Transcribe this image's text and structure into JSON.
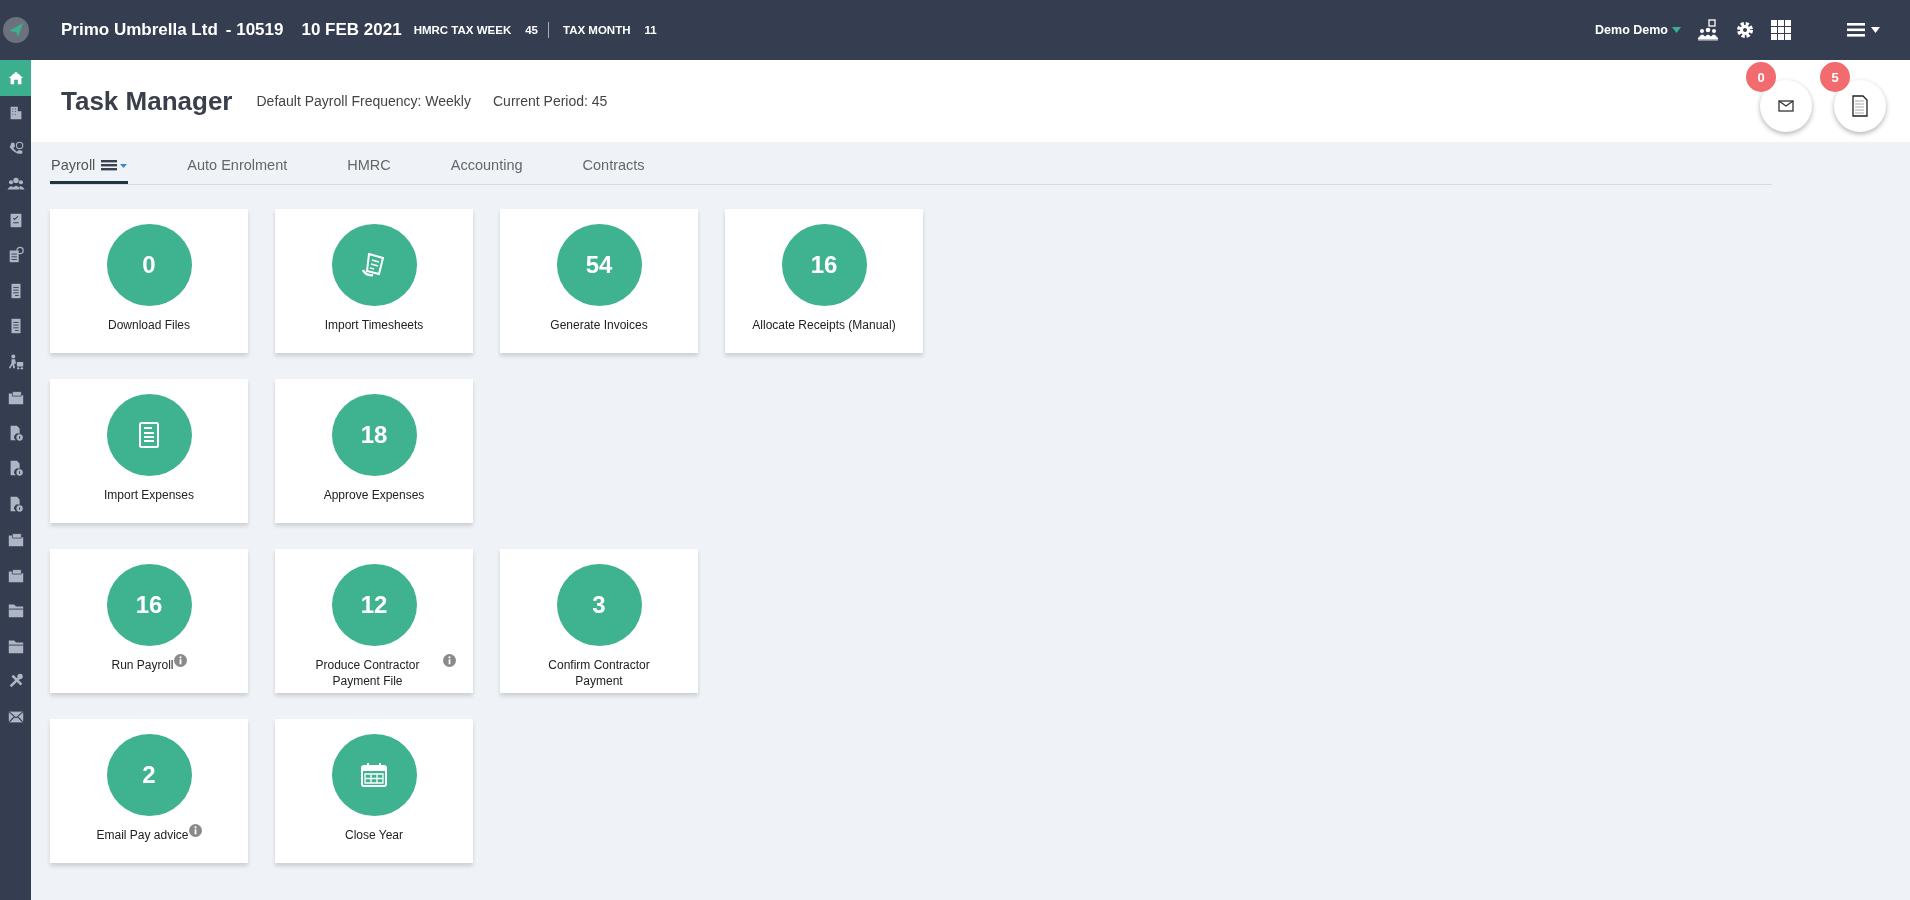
{
  "topbar": {
    "company": "Primo Umbrella Ltd",
    "code": "- 10519",
    "date": "10 FEB 2021",
    "tax_week_label": "HMRC TAX WEEK",
    "tax_week": "45",
    "tax_month_label": "TAX MONTH",
    "tax_month": "11",
    "user": "Demo Demo"
  },
  "sidebar": {
    "items": [
      {
        "kind": "home",
        "selected": true
      },
      {
        "kind": "building",
        "selected": false
      },
      {
        "kind": "phone",
        "selected": false
      },
      {
        "kind": "people",
        "selected": false
      },
      {
        "kind": "clipboard",
        "selected": false
      },
      {
        "kind": "docbadge",
        "selected": false
      },
      {
        "kind": "doc",
        "selected": false
      },
      {
        "kind": "doc",
        "selected": false
      },
      {
        "kind": "worker",
        "selected": false
      },
      {
        "kind": "folderdoc",
        "selected": false
      },
      {
        "kind": "docinfo",
        "selected": false
      },
      {
        "kind": "docinfo",
        "selected": false
      },
      {
        "kind": "docinfo",
        "selected": false
      },
      {
        "kind": "folderdoc",
        "selected": false
      },
      {
        "kind": "folderdoc",
        "selected": false
      },
      {
        "kind": "folder",
        "selected": false
      },
      {
        "kind": "folder",
        "selected": false
      },
      {
        "kind": "tools",
        "selected": false
      },
      {
        "kind": "mail",
        "selected": false
      }
    ]
  },
  "header": {
    "title": "Task Manager",
    "frequency": "Default Payroll Frequency: Weekly",
    "period": "Current Period: 45",
    "messages_badge": "0",
    "documents_badge": "5"
  },
  "tabs": [
    {
      "label": "Payroll",
      "selected": true,
      "menu": true
    },
    {
      "label": "Auto Enrolment",
      "selected": false,
      "menu": false
    },
    {
      "label": "HMRC",
      "selected": false,
      "menu": false
    },
    {
      "label": "Accounting",
      "selected": false,
      "menu": false
    },
    {
      "label": "Contracts",
      "selected": false,
      "menu": false
    }
  ],
  "card_rows": [
    [
      {
        "kind": "count",
        "count": "0",
        "label": "Download Files",
        "info": false
      },
      {
        "kind": "timesheet",
        "label": "Import Timesheets",
        "info": false
      },
      {
        "kind": "count",
        "count": "54",
        "label": "Generate Invoices",
        "info": false
      },
      {
        "kind": "count",
        "count": "16",
        "label": "Allocate Receipts (Manual)",
        "info": false
      }
    ],
    [
      {
        "kind": "expenses",
        "label": "Import Expenses",
        "info": false
      },
      {
        "kind": "count",
        "count": "18",
        "label": "Approve Expenses",
        "info": false
      }
    ],
    [
      {
        "kind": "count",
        "count": "16",
        "label": "Run Payroll",
        "info": true
      },
      {
        "kind": "count",
        "count": "12",
        "label": "Produce Contractor Payment File",
        "info": true
      },
      {
        "kind": "count",
        "count": "3",
        "label": "Confirm Contractor Payment",
        "info": false
      }
    ],
    [
      {
        "kind": "count",
        "count": "2",
        "label": "Email Pay advice",
        "info": true
      },
      {
        "kind": "calendar",
        "label": "Close Year",
        "info": false
      }
    ]
  ]
}
